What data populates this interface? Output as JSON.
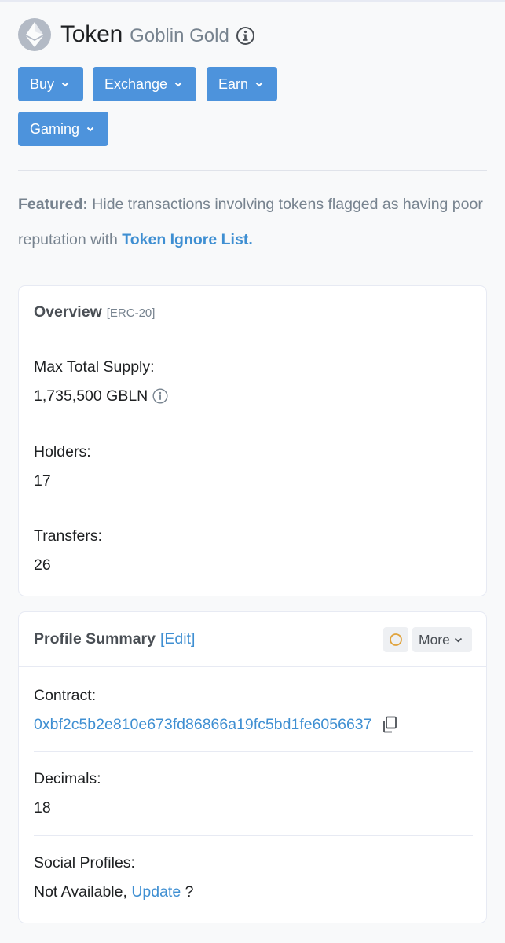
{
  "header": {
    "title": "Token",
    "token_name": "Goblin Gold",
    "icons": {
      "logo": "ethereum-logo-icon",
      "info": "info-circle-icon"
    }
  },
  "nav_buttons": [
    {
      "label": "Buy"
    },
    {
      "label": "Exchange"
    },
    {
      "label": "Earn"
    },
    {
      "label": "Gaming"
    }
  ],
  "featured": {
    "prefix": "Featured:",
    "text": " Hide transactions involving tokens flagged as having poor reputation with ",
    "link": "Token Ignore List."
  },
  "overview": {
    "title": "Overview",
    "subtitle": "[ERC-20]",
    "rows": [
      {
        "label": "Max Total Supply:",
        "value": "1,735,500 GBLN"
      },
      {
        "label": "Holders:",
        "value": "17"
      },
      {
        "label": "Transfers:",
        "value": "26"
      }
    ]
  },
  "profile": {
    "title": "Profile Summary",
    "edit_label": "[Edit]",
    "more_label": "More",
    "contract_label": "Contract:",
    "contract_value": "0xbf2c5b2e810e673fd86866a19fc5bd1fe6056637",
    "decimals_label": "Decimals:",
    "decimals_value": "18",
    "social_label": "Social Profiles:",
    "social_value": "Not Available, ",
    "social_link": "Update",
    "social_suffix": " ?"
  },
  "colors": {
    "accent": "#4d93dc",
    "link": "#3f8fd2",
    "muted": "#77838f",
    "status_ring": "#e0a23a"
  }
}
